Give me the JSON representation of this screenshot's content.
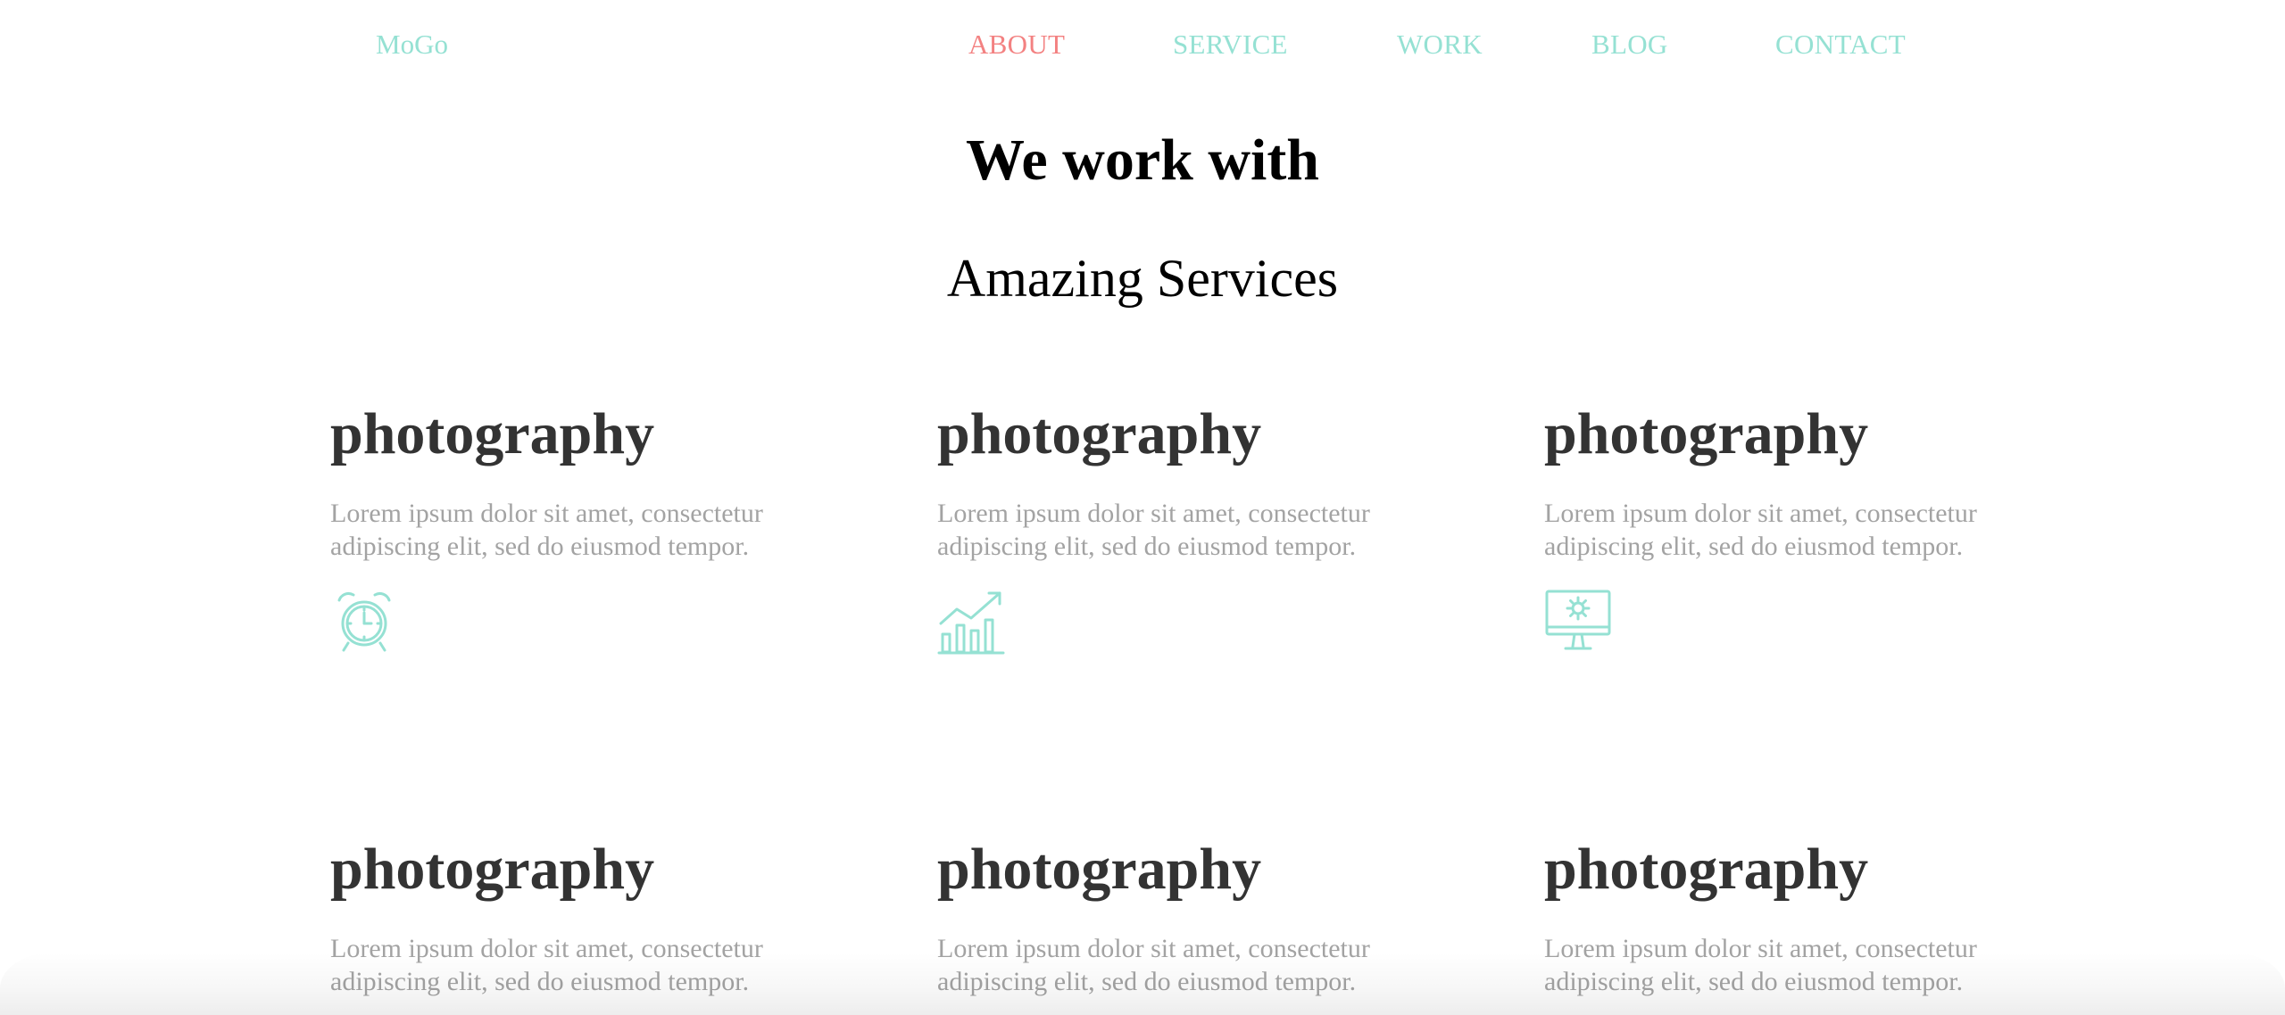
{
  "header": {
    "logo": "MoGo",
    "nav": [
      {
        "label": "ABOUT",
        "active": true
      },
      {
        "label": "SERVICE",
        "active": false
      },
      {
        "label": "WORK",
        "active": false
      },
      {
        "label": "BLOG",
        "active": false
      },
      {
        "label": "CONTACT",
        "active": false
      }
    ]
  },
  "section": {
    "title": "We work with",
    "subtitle": "Amazing Services"
  },
  "services": [
    {
      "title": "photography",
      "text": "Lorem ipsum dolor sit amet, consectetur adipiscing elit, sed do eiusmod tempor.",
      "icon": "alarm-clock-icon"
    },
    {
      "title": "photography",
      "text": "Lorem ipsum dolor sit amet, consectetur adipiscing elit, sed do eiusmod tempor.",
      "icon": "growth-chart-icon"
    },
    {
      "title": "photography",
      "text": "Lorem ipsum dolor sit amet, consectetur adipiscing elit, sed do eiusmod tempor.",
      "icon": "monitor-gear-icon"
    },
    {
      "title": "photography",
      "text": "Lorem ipsum dolor sit amet, consectetur adipiscing elit, sed do eiusmod tempor."
    },
    {
      "title": "photography",
      "text": "Lorem ipsum dolor sit amet, consectetur adipiscing elit, sed do eiusmod tempor."
    },
    {
      "title": "photography",
      "text": "Lorem ipsum dolor sit amet, consectetur adipiscing elit, sed do eiusmod tempor."
    }
  ],
  "colors": {
    "accent": "#95e1d3",
    "active": "#f38181",
    "heading": "#333333",
    "body_text": "#a3a3a3"
  }
}
